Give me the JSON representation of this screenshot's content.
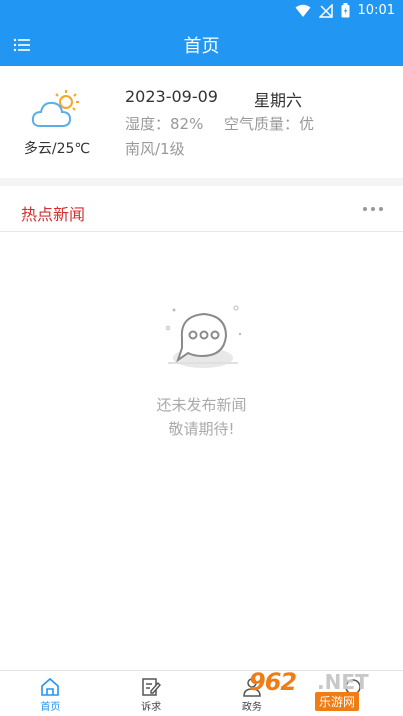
{
  "status_bar": {
    "time": "10:01"
  },
  "header": {
    "title": "首页"
  },
  "weather": {
    "condition": "多云/25℃",
    "date": "2023-09-09",
    "weekday": "星期六",
    "humidity": "湿度：82%",
    "air_quality": "空气质量：优",
    "wind": "南风/1级"
  },
  "news": {
    "section_title": "热点新闻",
    "empty_line1": "还未发布新闻",
    "empty_line2": "敬请期待!"
  },
  "tabs": [
    {
      "label": "首页",
      "icon": "home-icon"
    },
    {
      "label": "诉求",
      "icon": "edit-icon"
    },
    {
      "label": "政务",
      "icon": "person-icon"
    },
    {
      "label": "",
      "icon": "more-icon"
    }
  ],
  "watermark": {
    "logo_number": "962",
    "logo_suffix": ".NET",
    "logo_cn": "乐游网"
  },
  "colors": {
    "primary": "#2196f3",
    "accent_red": "#d32f2f",
    "watermark_orange": "#f07c14"
  }
}
